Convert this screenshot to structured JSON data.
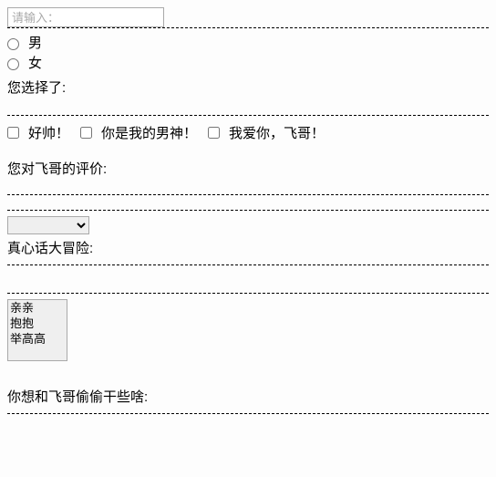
{
  "input": {
    "placeholder": "请输入："
  },
  "radios": {
    "opt1": "男",
    "opt2": "女",
    "result": "您选择了:"
  },
  "checks": {
    "opt1": "好帅！",
    "opt2": "你是我的男神！",
    "opt3": "我爱你，飞哥！",
    "result": "您对飞哥的评价:"
  },
  "dropdown": {
    "selected": "",
    "result": "真心话大冒险:"
  },
  "listbox": {
    "items": [
      "亲亲",
      "抱抱",
      "举高高"
    ],
    "result": "你想和飞哥偷偷干些啥:"
  }
}
